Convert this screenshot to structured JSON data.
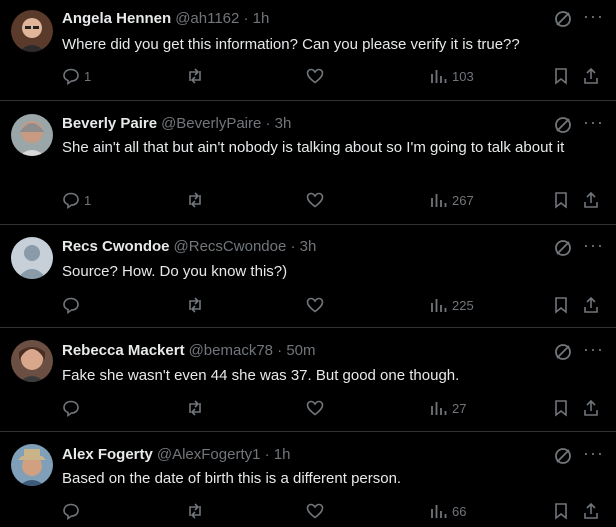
{
  "tweets": [
    {
      "name": "Angela Hennen",
      "meta": "@ah1162 · 1h",
      "text": "Where did you get this information?  Can you please verify it is true??",
      "replies": "1",
      "retweets": "",
      "likes": "",
      "views": "103",
      "avatar": "woman-glasses-avatar"
    },
    {
      "name": "Beverly Paire",
      "meta": "@BeverlyPaire · 3h",
      "text": "She ain't all that but ain't nobody is talking about so I'm going to talk about it",
      "replies": "1",
      "retweets": "",
      "likes": "",
      "views": "267",
      "avatar": "woman-smiling-avatar"
    },
    {
      "name": "Recs Cwondoe",
      "meta": "@RecsCwondoe · 3h",
      "text": "Source? How. Do you know this?)",
      "replies": "",
      "retweets": "",
      "likes": "",
      "views": "225",
      "avatar": "default-avatar"
    },
    {
      "name": "Rebecca Mackert",
      "meta": "@bemack78 · 50m",
      "text": "Fake she wasn't even 44 she was 37. But good one though.",
      "replies": "",
      "retweets": "",
      "likes": "",
      "views": "27",
      "avatar": "woman-portrait-avatar"
    },
    {
      "name": "Alex Fogerty",
      "meta": "@AlexFogerty1 · 1h",
      "text": "Based on the date of birth this is a different person.",
      "replies": "",
      "retweets": "",
      "likes": "",
      "views": "66",
      "avatar": "man-hat-avatar"
    }
  ],
  "more_label": "···",
  "colors": {
    "background": "#000000",
    "text": "#e7e9ea",
    "muted": "#71767b",
    "divider": "#2f3336"
  }
}
